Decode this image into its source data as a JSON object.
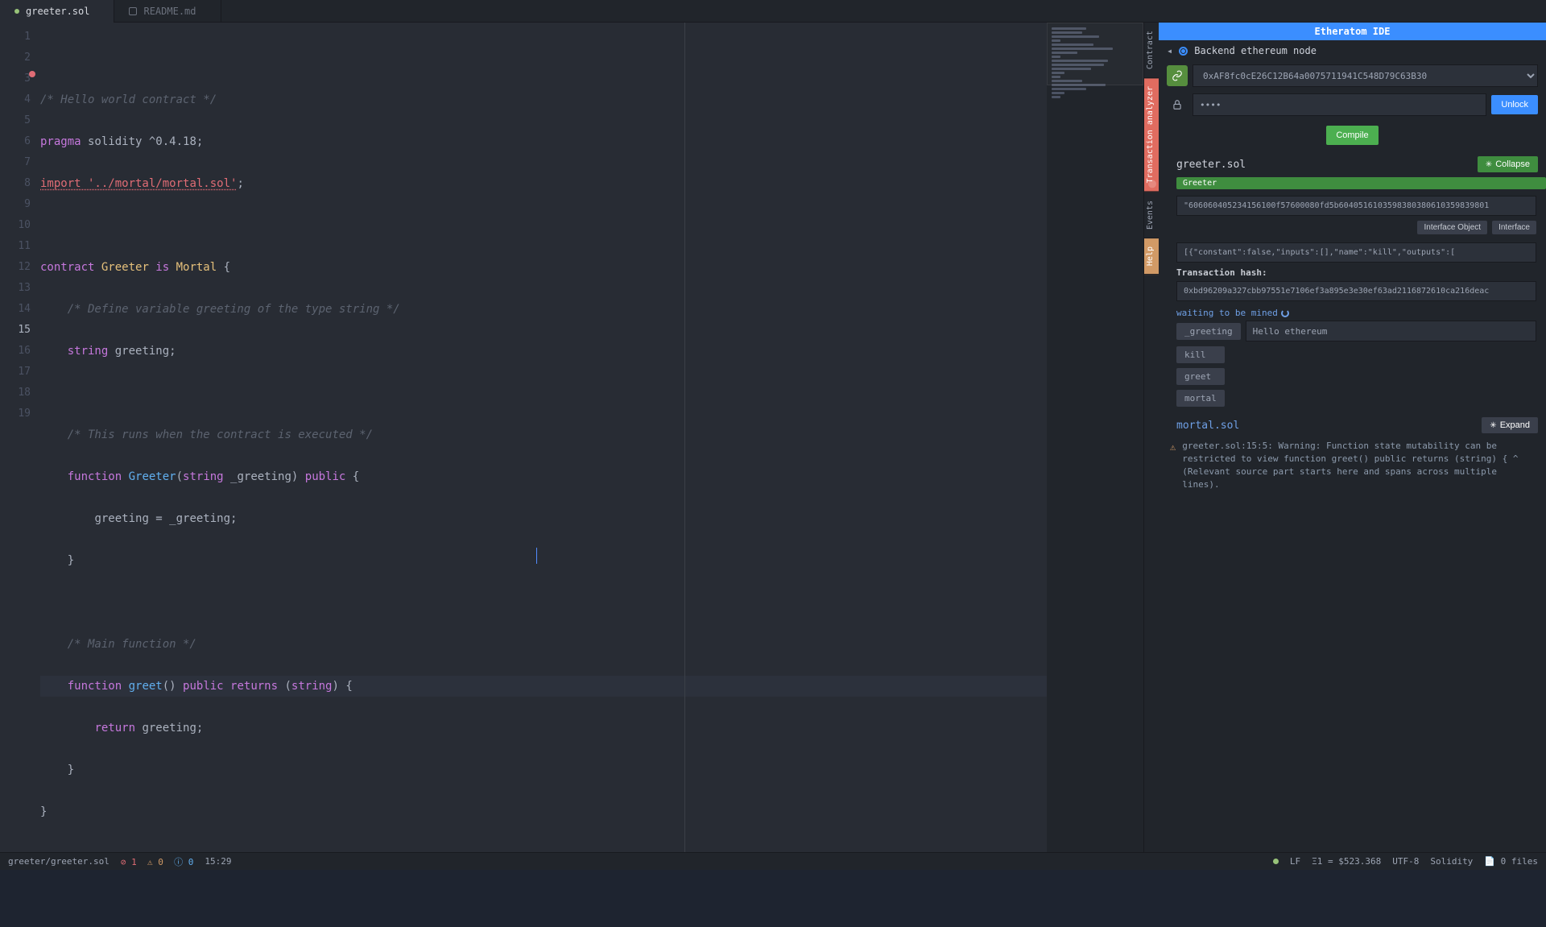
{
  "tabs": [
    {
      "label": "greeter.sol",
      "active": true
    },
    {
      "label": "README.md",
      "active": false
    }
  ],
  "gutter_lines": 19,
  "highlight_line": 15,
  "code": {
    "l1": "/* Hello world contract */",
    "l2_a": "pragma",
    "l2_b": " solidity ",
    "l2_c": "^0.4.18",
    "l2_d": ";",
    "l3_a": "import",
    "l3_b": " '../mortal/mortal.sol'",
    "l3_c": ";",
    "l5_a": "contract",
    "l5_b": " Greeter ",
    "l5_c": "is",
    "l5_d": " Mortal ",
    "l5_e": "{",
    "l6": "/* Define variable greeting of the type string */",
    "l7_a": "string",
    "l7_b": " greeting;",
    "l9": "/* This runs when the contract is executed */",
    "l10_a": "function",
    "l10_b": " Greeter",
    "l10_c": "(",
    "l10_d": "string",
    "l10_e": " _greeting) ",
    "l10_f": "public",
    "l10_g": " {",
    "l11": "greeting = _greeting;",
    "l12": "}",
    "l14": "/* Main function */",
    "l15_a": "function",
    "l15_b": " greet",
    "l15_c": "() ",
    "l15_d": "public",
    "l15_e": " returns ",
    "l15_f": "(",
    "l15_g": "string",
    "l15_h": ") {",
    "l16_a": "return",
    "l16_b": " greeting;",
    "l17": "}",
    "l18": "}"
  },
  "panel": {
    "title": "Etheratom IDE",
    "backend_label": "Backend ethereum node",
    "address": "0xAF8fc0cE26C12B64a0075711941C548D79C63B30",
    "password_mask": "●●●●",
    "unlock": "Unlock",
    "compile": "Compile",
    "file1": "greeter.sol",
    "collapse": "Collapse",
    "contract_badge": "Greeter",
    "bytecode": "\"606060405234156100f57600080fd5b6040516103598380380610359839801",
    "interface_obj_btn": "Interface Object",
    "interface_btn": "Interface",
    "abi": "[{\"constant\":false,\"inputs\":[],\"name\":\"kill\",\"outputs\":[",
    "txhash_label": "Transaction hash:",
    "txhash": "0xbd96209a327cbb97551e7106ef3a895e3e30ef63ad2116872610ca216deac",
    "mined": "waiting to be mined",
    "fn_greeting_label": "_greeting",
    "fn_greeting_value": "Hello ethereum",
    "fn_kill": "kill",
    "fn_greet": "greet",
    "fn_mortal": "mortal",
    "file2": "mortal.sol",
    "expand": "Expand",
    "warning": "greeter.sol:15:5: Warning: Function state mutability can be restricted to view function greet() public returns (string) { ^ (Relevant source part starts here and spans across multiple lines).",
    "vtabs": {
      "contract": "Contract",
      "txan": "Transaction analyzer",
      "events": "Events",
      "help": "Help"
    }
  },
  "status": {
    "path": "greeter/greeter.sol",
    "errors": "1",
    "warnings": "0",
    "info": "0",
    "cursor": "15:29",
    "lf": "LF",
    "eth": "Ξ1 = $523.368",
    "encoding": "UTF-8",
    "lang": "Solidity",
    "files": "0 files"
  }
}
